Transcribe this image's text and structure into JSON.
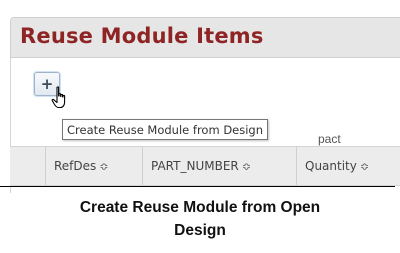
{
  "panel": {
    "title": "Reuse Module Items",
    "add_button_icon": "+",
    "tooltip": "Create Reuse Module from Design",
    "partial_text_behind": "pact",
    "columns": [
      {
        "label": "RefDes"
      },
      {
        "label": "PART_NUMBER"
      },
      {
        "label": "Quantity"
      }
    ],
    "sort_icon": "≎"
  },
  "caption": {
    "line1": "Create Reuse Module from Open",
    "line2": "Design"
  },
  "colors": {
    "title": "#8e2424",
    "titlebar_bg": "#e6e6e6",
    "header_bg": "#ececec"
  }
}
